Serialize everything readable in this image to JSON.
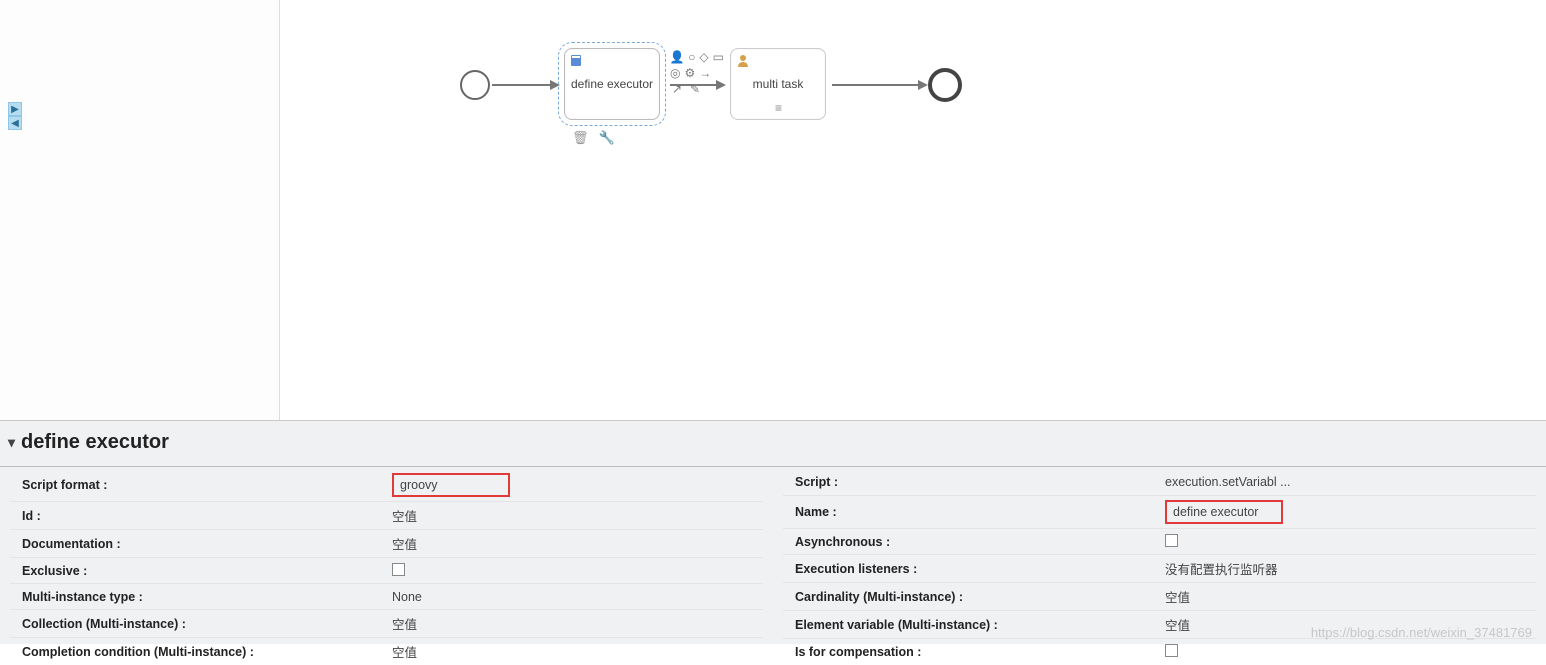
{
  "canvas": {
    "start_event": {
      "name": "start-event"
    },
    "end_event": {
      "name": "end-event"
    },
    "script_task": {
      "label": "define executor",
      "icon": "script-icon"
    },
    "user_task": {
      "label": "multi task",
      "icon": "user-icon"
    },
    "context_icons": {
      "row1": [
        "person-icon",
        "circle-icon",
        "diamond-icon",
        "document-icon"
      ],
      "row2": [
        "circle-end-icon",
        "gear-icon",
        "arrow-icon",
        ""
      ],
      "row3": [
        "arrow-up-icon",
        "edit-icon",
        "",
        ""
      ],
      "bottom": [
        "trash-icon",
        "wrench-icon"
      ]
    },
    "splitter_icons": [
      "expand-right-icon",
      "collapse-left-icon"
    ]
  },
  "properties": {
    "title": "define executor",
    "left": [
      {
        "label": "Script format :",
        "value": "groovy",
        "highlight": true
      },
      {
        "label": "Id :",
        "value": "空值"
      },
      {
        "label": "Documentation :",
        "value": "空值"
      },
      {
        "label": "Exclusive :",
        "value": "",
        "checkbox": true
      },
      {
        "label": "Multi-instance type :",
        "value": "None"
      },
      {
        "label": "Collection (Multi-instance) :",
        "value": "空值"
      },
      {
        "label": "Completion condition (Multi-instance) :",
        "value": "空值"
      }
    ],
    "right": [
      {
        "label": "Script :",
        "value": "execution.setVariabl ..."
      },
      {
        "label": "Name :",
        "value": "define executor",
        "highlight": true
      },
      {
        "label": "Asynchronous :",
        "value": "",
        "checkbox": true
      },
      {
        "label": "Execution listeners :",
        "value": "没有配置执行监听器"
      },
      {
        "label": "Cardinality (Multi-instance) :",
        "value": "空值"
      },
      {
        "label": "Element variable (Multi-instance) :",
        "value": "空值"
      },
      {
        "label": "Is for compensation :",
        "value": "",
        "checkbox": true
      }
    ]
  },
  "watermark": "https://blog.csdn.net/weixin_37481769"
}
